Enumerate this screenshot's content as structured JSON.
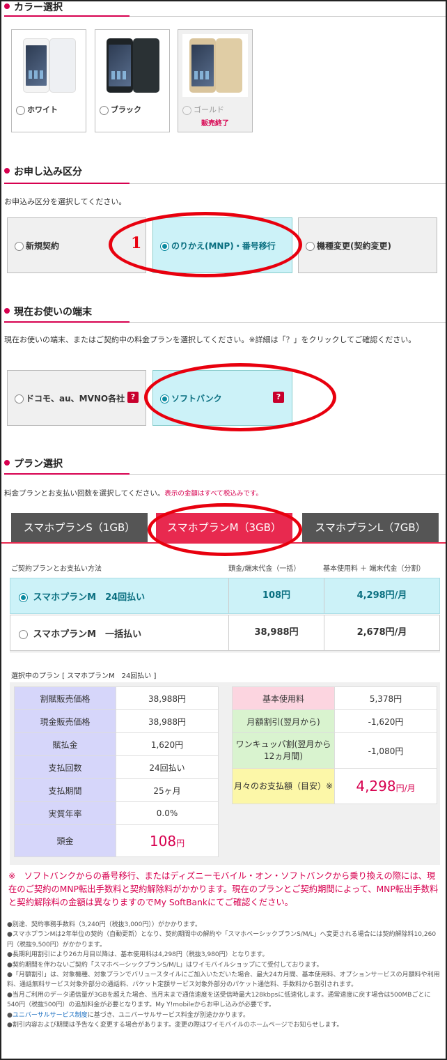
{
  "sections": {
    "color": "カラー選択",
    "apply": "お申し込み区分",
    "device": "現在お使いの端末",
    "plan": "プラン選択"
  },
  "colors": [
    {
      "label": "ホワイト",
      "disabled": false
    },
    {
      "label": "ブラック",
      "disabled": false
    },
    {
      "label": "ゴールド",
      "disabled": true,
      "status": "販売終了"
    }
  ],
  "apply": {
    "desc": "お申込み区分を選択してください。",
    "options": [
      "新規契約",
      "のりかえ(MNP)・番号移行",
      "機種変更(契約変更)"
    ],
    "selected": 1,
    "annotation_number": "1"
  },
  "device": {
    "desc": "現在お使いの端末、またはご契約中の料金プランを選択してください。※詳細は「？」をクリックしてご確認ください。",
    "options": [
      "ドコモ、au、MVNO各社",
      "ソフトバンク"
    ],
    "help": "?",
    "selected": 1
  },
  "plan": {
    "desc": "料金プランとお支払い回数を選択してください。",
    "desc_note": "表示の金額はすべて税込みです。",
    "tabs": [
      "スマホプランS（1GB）",
      "スマホプランM（3GB）",
      "スマホプランL（7GB）"
    ],
    "selected_tab": 1,
    "headers": [
      "ご契約プランとお支払い方法",
      "頭金/端末代金（一括）",
      "基本使用料 ＋ 端末代金（分割）"
    ],
    "rows": [
      {
        "name": "スマホプランM　24回払い",
        "down": "108円",
        "monthly": "4,298円/月",
        "selected": true
      },
      {
        "name": "スマホプランM　一括払い",
        "down": "38,988円",
        "monthly": "2,678円/月",
        "selected": false
      }
    ],
    "selected_label": "選択中のプラン [ スマホプランM　24回払い ]"
  },
  "detail_left": [
    {
      "k": "割賦販売価格",
      "v": "38,988円"
    },
    {
      "k": "現金販売価格",
      "v": "38,988円"
    },
    {
      "k": "賦払金",
      "v": "1,620円"
    },
    {
      "k": "支払回数",
      "v": "24回払い"
    },
    {
      "k": "支払期間",
      "v": "25ヶ月"
    },
    {
      "k": "実質年率",
      "v": "0.0%"
    },
    {
      "k": "頭金",
      "v_big": "108",
      "v_unit": "円"
    }
  ],
  "detail_right": [
    {
      "k": "基本使用料",
      "v": "5,378円",
      "color": "#fcd5e0"
    },
    {
      "k": "月額割引(翌月から)",
      "v": "-1,620円",
      "color": "#d9f3cf"
    },
    {
      "k": "ワンキュッパ割(翌月から12ヵ月間)",
      "v": "-1,080円",
      "color": "#d9f3cf"
    },
    {
      "k": "月々のお支払額（目安）※",
      "v_big": "4,298",
      "v_unit": "円/月",
      "color": "#fcf7a8"
    }
  ],
  "warning": "※　ソフトバンクからの番号移行、またはディズニーモバイル・オン・ソフトバンクから乗り換えの際には、現在のご契約のMNP転出手数料と契約解除料がかかります。現在のプランとご契約期間によって、MNP転出手数料と契約解除料の金額は異なりますのでMy SoftBankにてご確認ください。",
  "notes": [
    "●別途、契約事務手数料（3,240円（税抜3,000円））がかかります。",
    "●スマホプランMは2年単位の契約（自動更新）となり、契約期間中の解約や「スマホベーシックプランS/M/L」へ変更される場合には契約解除料10,260円（税抜9,500円）がかかります。",
    "●長期利用割引により26カ月目以降は、基本使用料は4,298円（税抜3,980円）となります。",
    "●契約期間を伴わないご契約「スマホベーシックプランS/M/L」はワイモバイルショップにて受付しております。",
    "●「月額割引」は、対象機種、対象プランでバリュースタイルにご加入いただいた場合、最大24カ月間、基本使用料、オプションサービスの月額料や利用料、通話無料サービス対象外部分の通話料、パケット定額サービス対象外部分のパケット通信料、手数料から割引されます。",
    "●当月ご利用のデータ通信量が3GBを超えた場合、当月末まで通信速度を送受信時最大128kbpsに低速化します。通常速度に戻す場合は500MBごとに540円（税抜500円）の追加料金が必要となります。My Y!mobileからお申し込みが必要です。"
  ],
  "note_universal": {
    "prefix": "●",
    "link": "ユニバーサルサービス制度",
    "rest": "に基づき、ユニバーサルサービス料金が別途かかります。"
  },
  "note_last": "●割引内容および期間は予告なく変更する場合があります。変更の際はワイモバイルのホームページでお知らせします。"
}
